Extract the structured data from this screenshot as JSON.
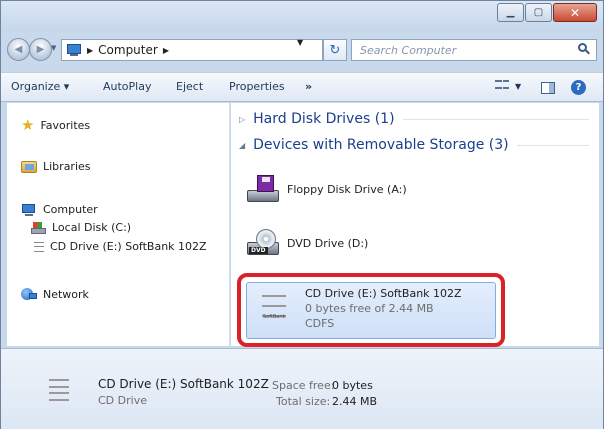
{
  "window": {
    "caption": {
      "minimize": "▁",
      "maximize": "▢",
      "close": "✕"
    }
  },
  "address": {
    "location": "Computer",
    "search_placeholder": "Search Computer"
  },
  "toolbar": {
    "organize": "Organize ▾",
    "autoplay": "AutoPlay",
    "eject": "Eject",
    "properties": "Properties",
    "more": "»"
  },
  "nav": {
    "favorites": "Favorites",
    "libraries": "Libraries",
    "computer": "Computer",
    "local_disk": "Local Disk (C:)",
    "cd_drive": "CD Drive (E:) SoftBank 102Z",
    "network": "Network"
  },
  "content": {
    "group_hdd": "Hard Disk Drives (1)",
    "group_removable": "Devices with Removable Storage (3)",
    "floppy": "Floppy Disk Drive (A:)",
    "dvd": "DVD Drive (D:)",
    "dvd_badge": "DVD",
    "cd_title": "CD Drive (E:) SoftBank 102Z",
    "cd_free": "0 bytes free of 2.44 MB",
    "cd_fs": "CDFS",
    "cd_brand": "SoftBank"
  },
  "details": {
    "name": "CD Drive (E:) SoftBank 102Z",
    "type": "CD Drive",
    "space_free_label": "Space free:",
    "space_free_value": "0 bytes",
    "total_size_label": "Total size:",
    "total_size_value": "2.44 MB"
  },
  "colors": {
    "highlight": "#d9222a",
    "group_header": "#1b3f8c",
    "selection": "#cfe0f7"
  }
}
